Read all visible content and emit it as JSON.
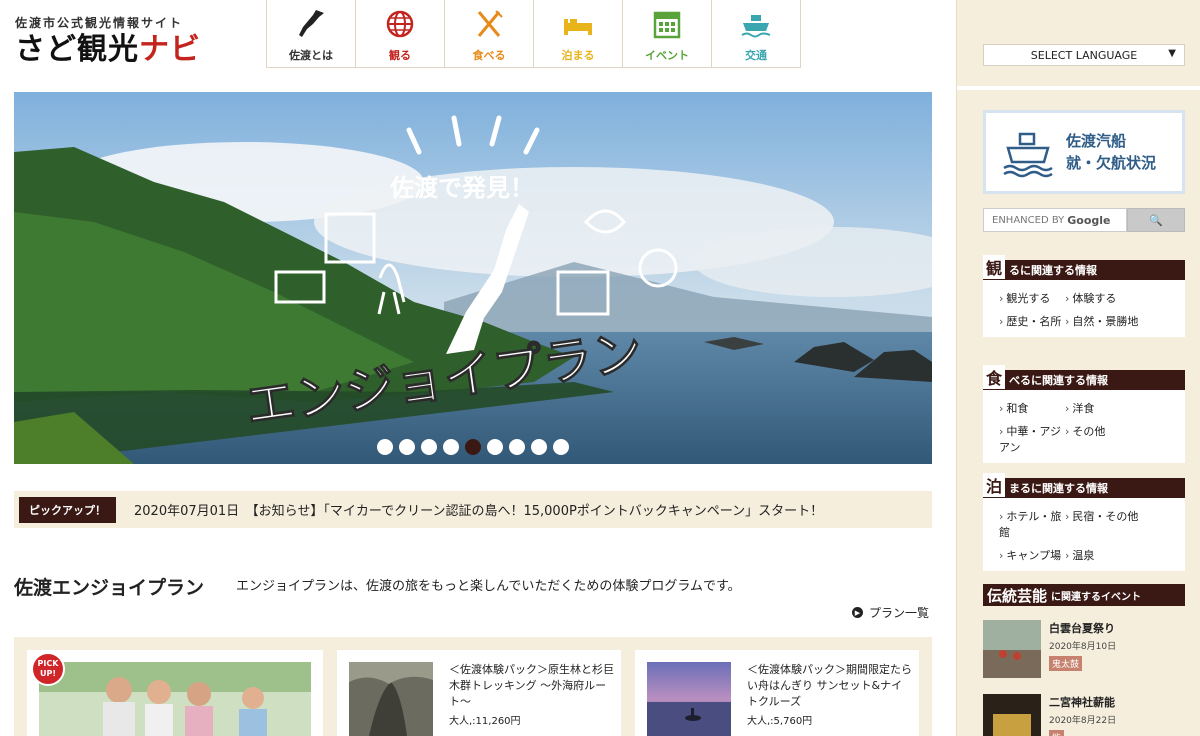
{
  "logo": {
    "small": "佐渡市公式観光情報サイト",
    "main_1": "さど観光",
    "main_2": "ナビ"
  },
  "nav": [
    {
      "label": "佐渡とは",
      "icon": "sado-island-icon",
      "color": "#333333"
    },
    {
      "label": "観る",
      "icon": "globe-icon",
      "color": "#c3241e"
    },
    {
      "label": "食べる",
      "icon": "fork-knife-icon",
      "color": "#e88a1a"
    },
    {
      "label": "泊まる",
      "icon": "bed-icon",
      "color": "#e8b41a"
    },
    {
      "label": "イベント",
      "icon": "calendar-icon",
      "color": "#5aa33a"
    },
    {
      "label": "交通",
      "icon": "ship-icon",
      "color": "#3aa6b0"
    }
  ],
  "hero": {
    "tagline": "佐渡で発見！",
    "headline": "エンジョイプラン",
    "slide_count": 9,
    "active_slide": 5
  },
  "pickup": {
    "badge": "ピックアップ！",
    "text": "2020年07月01日　【お知らせ】「マイカーでクリーン認証の島へ！15,000Pポイントバックキャンペーン」スタート！"
  },
  "section": {
    "title": "佐渡エンジョイプラン",
    "description": "エンジョイプランは、佐渡の旅をもっと楽しんでいただくための体験プログラムです。",
    "link": "プラン一覧"
  },
  "cards": [
    {
      "badge": "PICK UP!",
      "title": "",
      "price": ""
    },
    {
      "title": "＜佐渡体験パック＞原生林と杉巨木群トレッキング ～外海府ルート～",
      "price": "大人,:11,260円"
    },
    {
      "title": "＜佐渡体験パック＞期間限定たらい舟はんぎり サンセット&ナイトクルーズ",
      "price": "大人,:5,760円"
    }
  ],
  "sidebar": {
    "language": "SELECT LANGUAGE",
    "ferry": {
      "line1": "佐渡汽船",
      "line2": "就・欠航状況"
    },
    "search": {
      "placeholder_prefix": "ENHANCED BY",
      "placeholder_brand": "Google"
    },
    "sections": [
      {
        "big": "観",
        "rest": "るに関連する情報",
        "links": [
          "観光する",
          "体験する",
          "歴史・名所",
          "自然・景勝地"
        ]
      },
      {
        "big": "食",
        "rest": "べるに関連する情報",
        "links": [
          "和食",
          "洋食",
          "中華・アジアン",
          "その他"
        ]
      },
      {
        "big": "泊",
        "rest": "まるに関連する情報",
        "links": [
          "ホテル・旅館",
          "民宿・その他",
          "キャンプ場",
          "温泉"
        ]
      }
    ],
    "events_head": {
      "big": "伝統芸能",
      "rest": "に関連するイベント"
    },
    "events": [
      {
        "title": "白雲台夏祭り",
        "date": "2020年8月10日",
        "tag": "鬼太鼓"
      },
      {
        "title": "二宮神社薪能",
        "date": "2020年8月22日",
        "tag": "能"
      }
    ]
  },
  "colors": {
    "brown": "#3a1814",
    "beige": "#f5eedd",
    "red": "#c3241e"
  }
}
